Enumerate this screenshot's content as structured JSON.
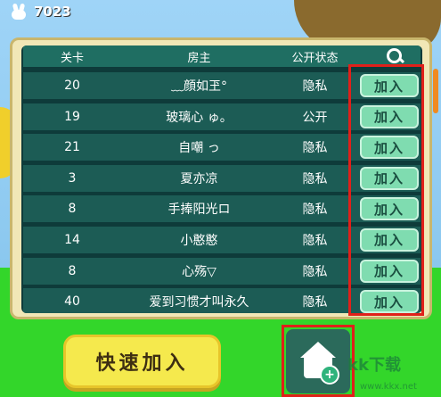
{
  "player": {
    "coins": "7023"
  },
  "table": {
    "headers": {
      "level": "关卡",
      "owner": "房主",
      "status": "公开状态"
    },
    "join_label": "加入",
    "rows": [
      {
        "level": "20",
        "owner": "﹏顔如玊°",
        "status": "隐私"
      },
      {
        "level": "19",
        "owner": "玻璃心 ゅ。",
        "status": "公开"
      },
      {
        "level": "21",
        "owner": "自嘲 っ",
        "status": "隐私"
      },
      {
        "level": "3",
        "owner": "夏亦凉",
        "status": "隐私"
      },
      {
        "level": "8",
        "owner": "手捧阳光ロ",
        "status": "隐私"
      },
      {
        "level": "14",
        "owner": "小憨憨",
        "status": "隐私"
      },
      {
        "level": "8",
        "owner": "心殇▽",
        "status": "隐私"
      },
      {
        "level": "40",
        "owner": "爱到习惯才叫永久",
        "status": "隐私"
      }
    ]
  },
  "buttons": {
    "quick_join": "快速加入"
  },
  "watermark": {
    "main": "kk下载",
    "sub": "www.kkx.net"
  },
  "colors": {
    "highlight": "#e0201a",
    "join_button": "#7fdcb0",
    "row_bg": "#1c5c55"
  }
}
